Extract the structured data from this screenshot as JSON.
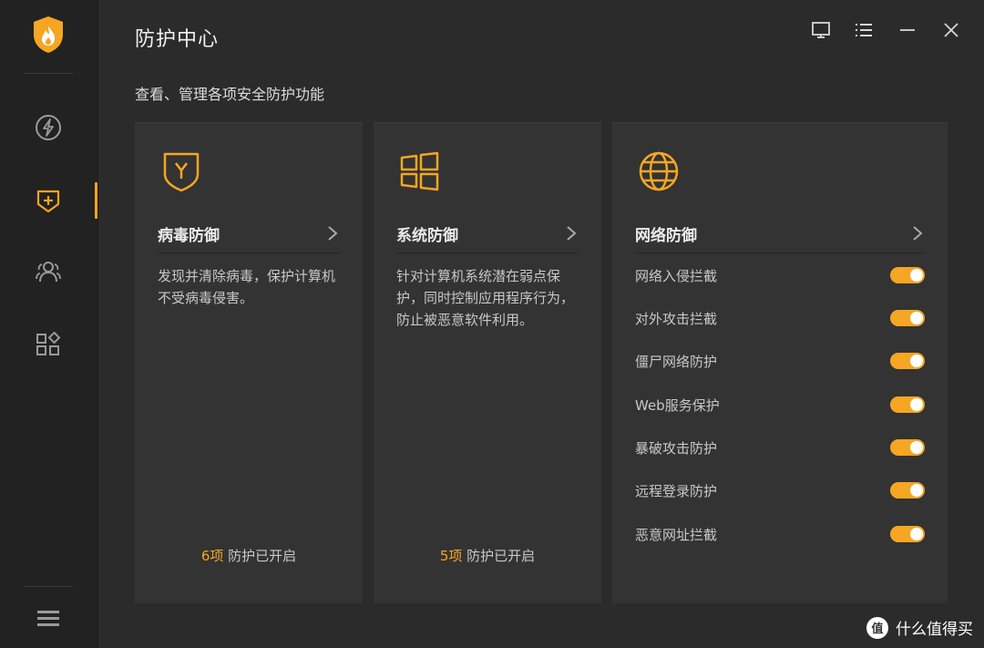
{
  "app": {
    "title": "防护中心",
    "subtitle": "查看、管理各项安全防护功能"
  },
  "sidebar": {
    "items": [
      {
        "icon": "bolt-icon",
        "active": false
      },
      {
        "icon": "shield-plus-icon",
        "active": true
      },
      {
        "icon": "users-icon",
        "active": false
      },
      {
        "icon": "apps-icon",
        "active": false
      }
    ],
    "menu_icon": "hamburger-menu-icon"
  },
  "window_controls": [
    "feedback-icon",
    "menu-list-icon",
    "minimize-icon",
    "close-icon"
  ],
  "cards": {
    "virus": {
      "title": "病毒防御",
      "desc": "发现并清除病毒，保护计算机不受病毒侵害。",
      "count": "6项",
      "status": "防护已开启"
    },
    "system": {
      "title": "系统防御",
      "desc": "针对计算机系统潜在弱点保护，同时控制应用程序行为，防止被恶意软件利用。",
      "count": "5项",
      "status": "防护已开启"
    },
    "network": {
      "title": "网络防御",
      "toggles": [
        {
          "label": "网络入侵拦截",
          "on": true
        },
        {
          "label": "对外攻击拦截",
          "on": true
        },
        {
          "label": "僵尸网络防护",
          "on": true
        },
        {
          "label": "Web服务保护",
          "on": true
        },
        {
          "label": "暴破攻击防护",
          "on": true
        },
        {
          "label": "远程登录防护",
          "on": true
        },
        {
          "label": "恶意网址拦截",
          "on": true
        }
      ]
    }
  },
  "colors": {
    "accent": "#f5a623",
    "background": "#2b2b2b",
    "card": "#333333",
    "sidebar": "#222222"
  },
  "watermark": {
    "badge": "值",
    "text": "什么值得买"
  }
}
